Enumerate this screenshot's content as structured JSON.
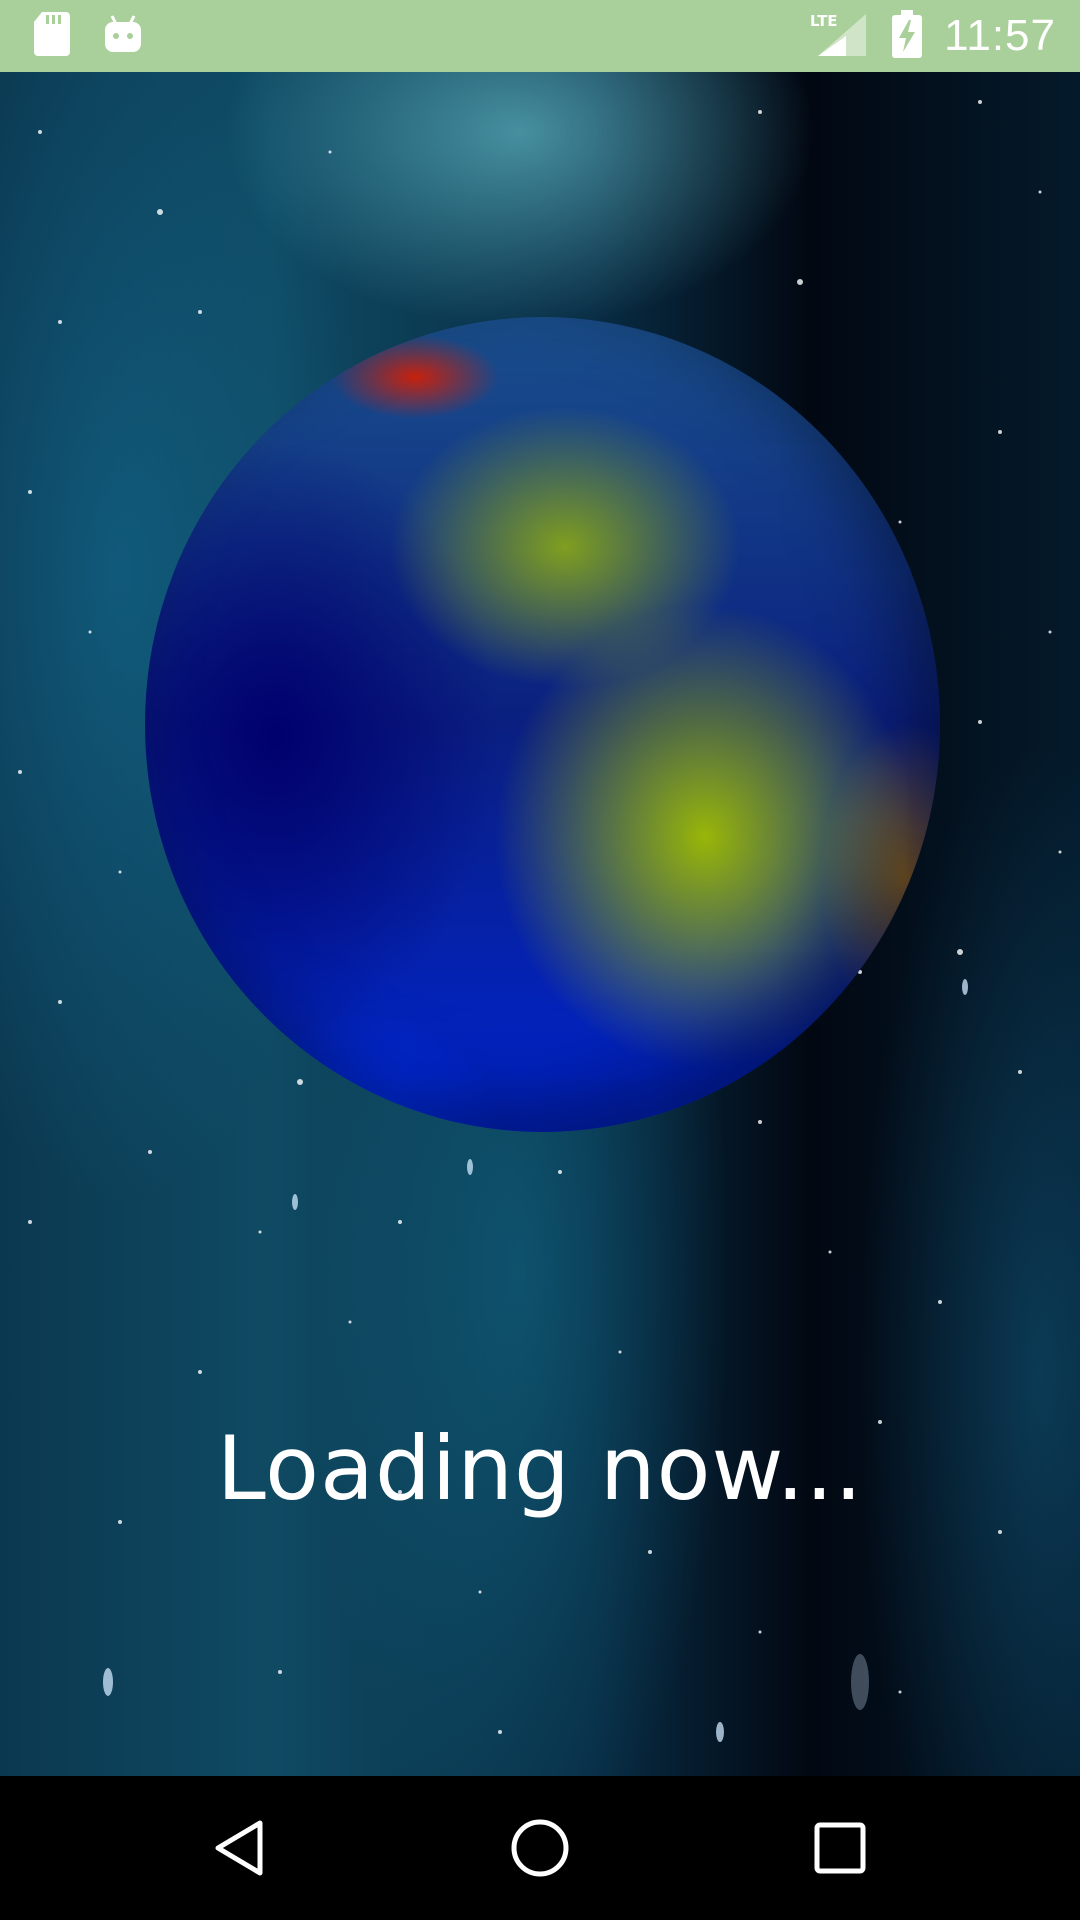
{
  "status_bar": {
    "time": "11:57",
    "network": "LTE",
    "icons": [
      "sd-card-icon",
      "android-icon",
      "lte-signal-icon",
      "battery-charging-icon"
    ]
  },
  "main": {
    "loading_text": "Loading now..."
  },
  "nav_bar": {
    "icons": [
      "back-icon",
      "home-icon",
      "recents-icon"
    ]
  },
  "colors": {
    "status_bar_bg": "#a9d09a",
    "nav_bar_bg": "#000000",
    "text": "#ffffff"
  }
}
